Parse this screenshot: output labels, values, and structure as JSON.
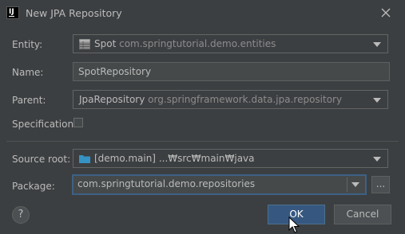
{
  "window": {
    "title": "New JPA Repository",
    "app_icon_text": "IJ"
  },
  "form": {
    "entity": {
      "label": "Entity:",
      "value_name": "Spot",
      "value_package": "com.springtutorial.demo.entities"
    },
    "name": {
      "label": "Name:",
      "value": "SpotRepository"
    },
    "parent": {
      "label": "Parent:",
      "value_name": "JpaRepository",
      "value_package": "org.springframework.data.jpa.repository"
    },
    "specification": {
      "label": "Specification:",
      "checked": false
    },
    "source_root": {
      "label": "Source root:",
      "value_module": "[demo.main]",
      "value_path": "...₩src₩main₩java"
    },
    "package": {
      "label": "Package:",
      "value": "com.springtutorial.demo.repositories",
      "browse_label": "..."
    }
  },
  "footer": {
    "help_label": "?",
    "ok_label": "OK",
    "cancel_label": "Cancel"
  },
  "colors": {
    "background": "#3c3f41",
    "text": "#bbbbbb",
    "focus_border": "#3d6185",
    "ok_button": "#365880",
    "folder_icon": "#3592c4"
  }
}
